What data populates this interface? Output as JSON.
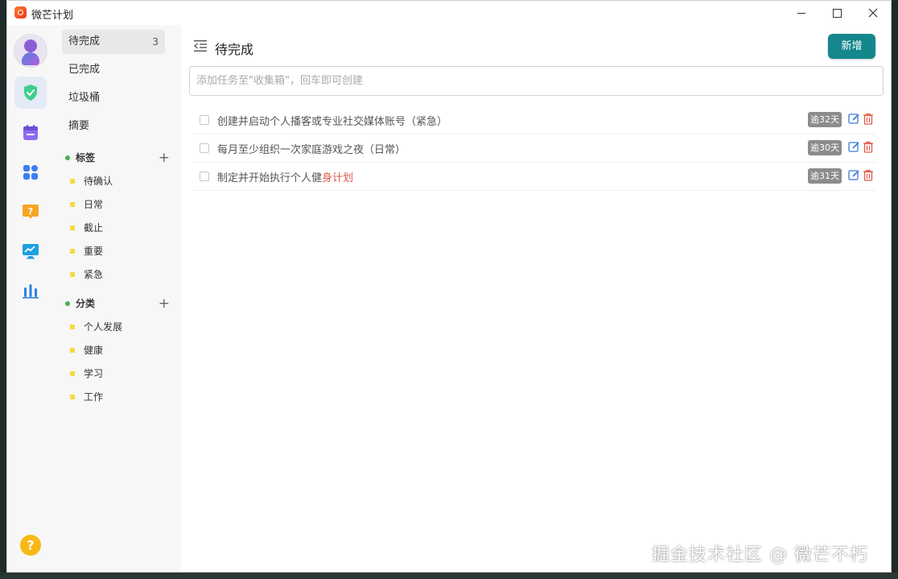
{
  "app": {
    "title": "微芒计划"
  },
  "nav": {
    "items": [
      {
        "label": "待完成",
        "count": "3"
      },
      {
        "label": "已完成"
      },
      {
        "label": "垃圾桶"
      },
      {
        "label": "摘要"
      }
    ],
    "tags": {
      "title": "标签",
      "add": "+",
      "items": [
        "待确认",
        "日常",
        "截止",
        "重要",
        "紧急"
      ]
    },
    "categories": {
      "title": "分类",
      "add": "+",
      "items": [
        "个人发展",
        "健康",
        "学习",
        "工作"
      ]
    }
  },
  "main": {
    "title": "待完成",
    "new_button": "新增",
    "input_placeholder": "添加任务至\"收集箱\"，回车即可创建",
    "tasks": [
      {
        "text": "创建并启动个人播客或专业社交媒体账号（紧急）",
        "overdue": "逾32天"
      },
      {
        "text": "每月至少组织一次家庭游戏之夜（日常）",
        "overdue": "逾30天"
      },
      {
        "text_main": "制定并开始执行个人健",
        "text_highlight": "身计划",
        "overdue": "逾31天"
      }
    ]
  },
  "watermark": "掘金技术社区 @ 微芒不朽",
  "colors": {
    "accent": "#13878c",
    "overdue_badge": "#8c8c8c",
    "tag_marker": "#f5d94a",
    "section_dot": "#4caf50",
    "delete": "#e05a4a",
    "edit": "#3a7bd5"
  },
  "icons": {
    "rail": [
      "avatar",
      "shield-check-icon",
      "calendar-icon",
      "apps-grid-icon",
      "help-bubble-icon",
      "monitor-chart-icon",
      "bar-chart-icon",
      "help-circle-icon"
    ]
  }
}
